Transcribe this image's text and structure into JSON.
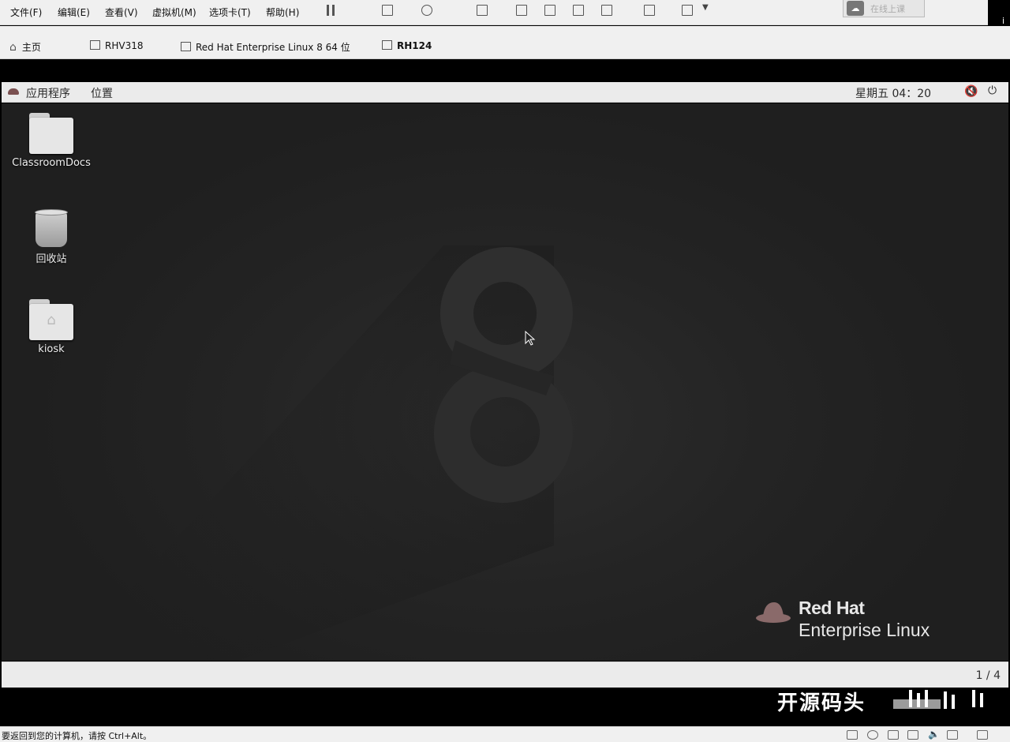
{
  "menubar": {
    "items": [
      "文件(F)",
      "编辑(E)",
      "查看(V)",
      "虚拟机(M)",
      "选项卡(T)",
      "帮助(H)"
    ],
    "cloud_label": "在线上课",
    "partial_char": "i"
  },
  "tabs": [
    {
      "label": "主页",
      "icon": "home-icon",
      "active": false
    },
    {
      "label": "RHV318",
      "icon": "vm-icon",
      "active": false
    },
    {
      "label": "Red Hat Enterprise Linux 8 64 位",
      "icon": "vm-icon",
      "active": false
    },
    {
      "label": "RH124",
      "icon": "vm-running-icon",
      "active": true
    }
  ],
  "gnome_topbar": {
    "applications": "应用程序",
    "places": "位置",
    "clock": "星期五 04：20",
    "volume_icon": "volume-muted-icon",
    "power_icon": "power-icon"
  },
  "desktop": {
    "icons": [
      {
        "label": "ClassroomDocs",
        "icon": "folder-icon"
      },
      {
        "label": "回收站",
        "icon": "trash-icon"
      },
      {
        "label": "kiosk",
        "icon": "home-folder-icon"
      }
    ],
    "wallpaper_digit": "8",
    "logo_line1": "Red Hat",
    "logo_line2": "Enterprise Linux"
  },
  "gnome_bottombar": {
    "workspace": "1 / 4"
  },
  "watermark": "开源码头",
  "statusbar": {
    "message": "要返回到您的计算机，请按 Ctrl+Alt。"
  },
  "colors": {
    "desktop_bg": "#242424",
    "panel_bg": "#ebebeb",
    "vmware_bg": "#f0f0f0",
    "redhat_hat": "#7a5050"
  }
}
